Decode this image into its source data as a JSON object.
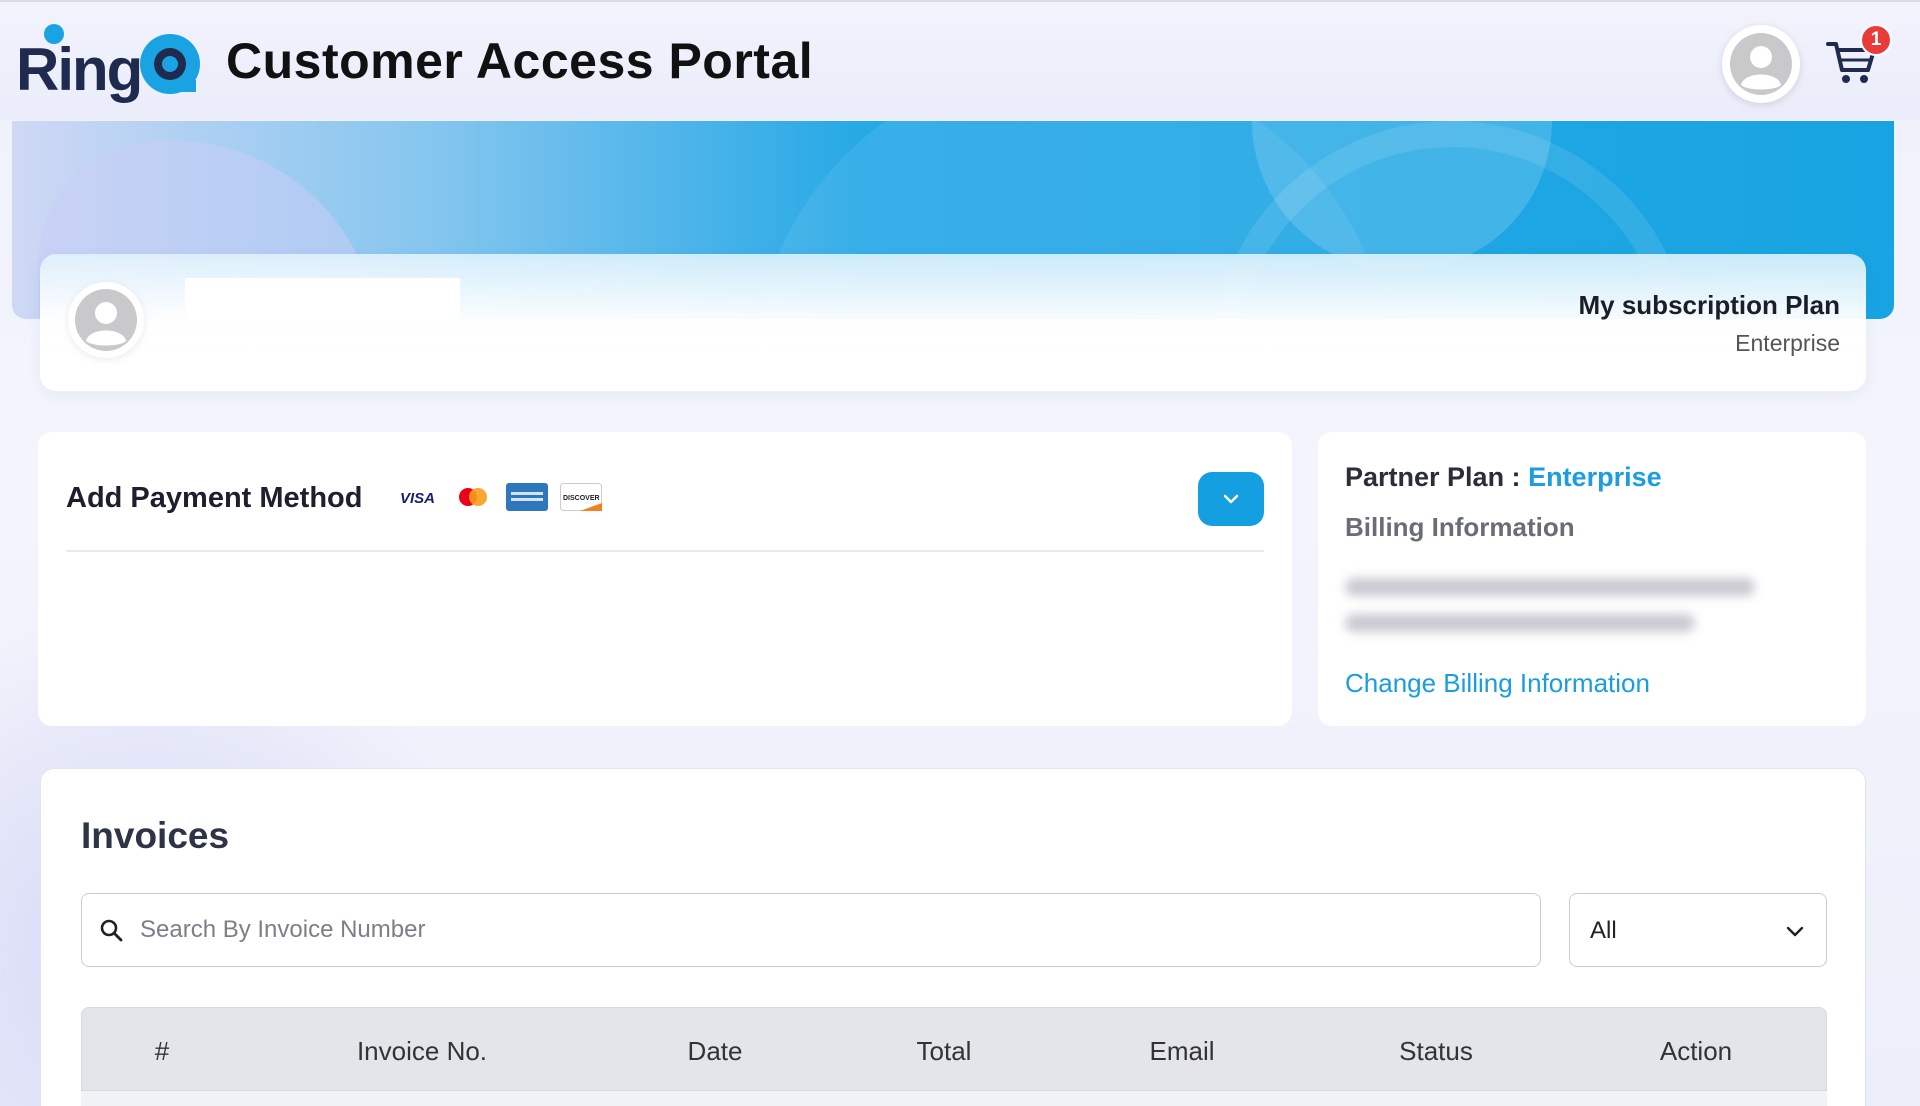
{
  "header": {
    "logo_text": "RingQ",
    "title": "Customer Access Portal",
    "cart_count": "1"
  },
  "profile": {
    "subscription_title": "My subscription Plan",
    "subscription_value": "Enterprise"
  },
  "payment": {
    "title": "Add Payment Method",
    "card_brands": [
      "VISA",
      "Mastercard",
      "American Express",
      "DISCOVER"
    ]
  },
  "billing": {
    "partner_label": "Partner Plan : ",
    "partner_value": "Enterprise",
    "section_title": "Billing Information",
    "change_link": "Change Billing Information"
  },
  "invoices": {
    "title": "Invoices",
    "search_placeholder": "Search By Invoice Number",
    "filter_value": "All",
    "columns": [
      "#",
      "Invoice No.",
      "Date",
      "Total",
      "Email",
      "Status",
      "Action"
    ]
  },
  "colors": {
    "accent": "#149fe0",
    "badge": "#ea3b3b",
    "link": "#1a9ddf"
  }
}
